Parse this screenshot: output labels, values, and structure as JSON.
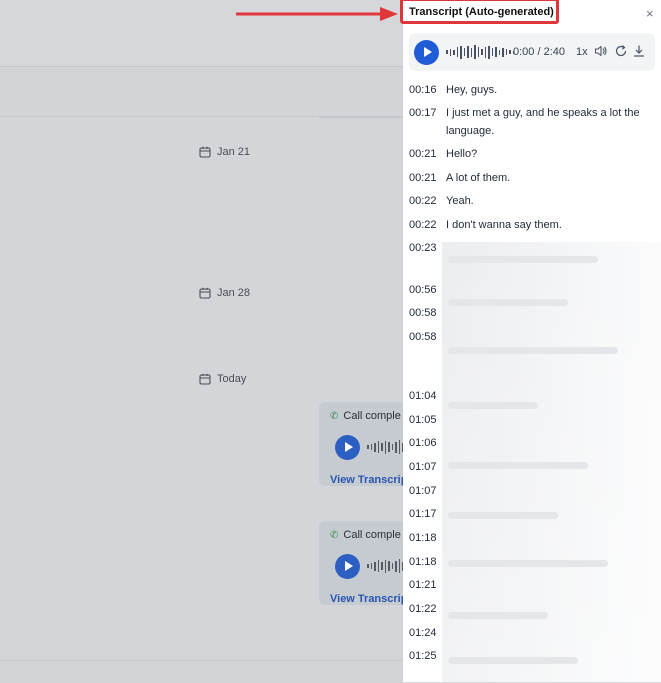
{
  "background": {
    "dates": [
      {
        "label": "Jan 21"
      },
      {
        "label": "Jan 28"
      },
      {
        "label": "Today"
      }
    ],
    "call_cards": [
      {
        "status": "Call comple",
        "view_label": "View Transcrip"
      },
      {
        "status": "Call comple",
        "view_label": "View Transcrip"
      }
    ]
  },
  "panel": {
    "title": "Transcript (Auto-generated)",
    "close_label": "×",
    "player": {
      "time": "0:00 / 2:40",
      "speed": "1x"
    },
    "lines": [
      {
        "time": "00:16",
        "text": "Hey, guys."
      },
      {
        "time": "00:17",
        "text": "I just met a guy, and he speaks a lot the language."
      },
      {
        "time": "00:21",
        "text": "Hello?"
      },
      {
        "time": "00:21",
        "text": "A lot of them."
      },
      {
        "time": "00:22",
        "text": "Yeah."
      },
      {
        "time": "00:22",
        "text": "I don't wanna say them."
      },
      {
        "time": "00:23",
        "text": ""
      },
      {
        "time": "00:56",
        "text": ""
      },
      {
        "time": "00:58",
        "text": ""
      },
      {
        "time": "00:58",
        "text": ""
      },
      {
        "time": "01:04",
        "text": ""
      },
      {
        "time": "01:05",
        "text": ""
      },
      {
        "time": "01:06",
        "text": ""
      },
      {
        "time": "01:07",
        "text": ""
      },
      {
        "time": "01:07",
        "text": ""
      },
      {
        "time": "01:17",
        "text": ""
      },
      {
        "time": "01:18",
        "text": ""
      },
      {
        "time": "01:18",
        "text": ""
      },
      {
        "time": "01:21",
        "text": ""
      },
      {
        "time": "01:22",
        "text": ""
      },
      {
        "time": "01:24",
        "text": ""
      },
      {
        "time": "01:25",
        "text": ""
      }
    ]
  },
  "colors": {
    "annotation": "#e0363a",
    "play_button": "#1f5cd6",
    "link": "#2a55b0",
    "call_icon": "#3c8a4b"
  },
  "icons": [
    "play-icon",
    "volume-icon",
    "refresh-icon",
    "download-icon",
    "close-icon",
    "calendar-icon",
    "phone-icon"
  ]
}
